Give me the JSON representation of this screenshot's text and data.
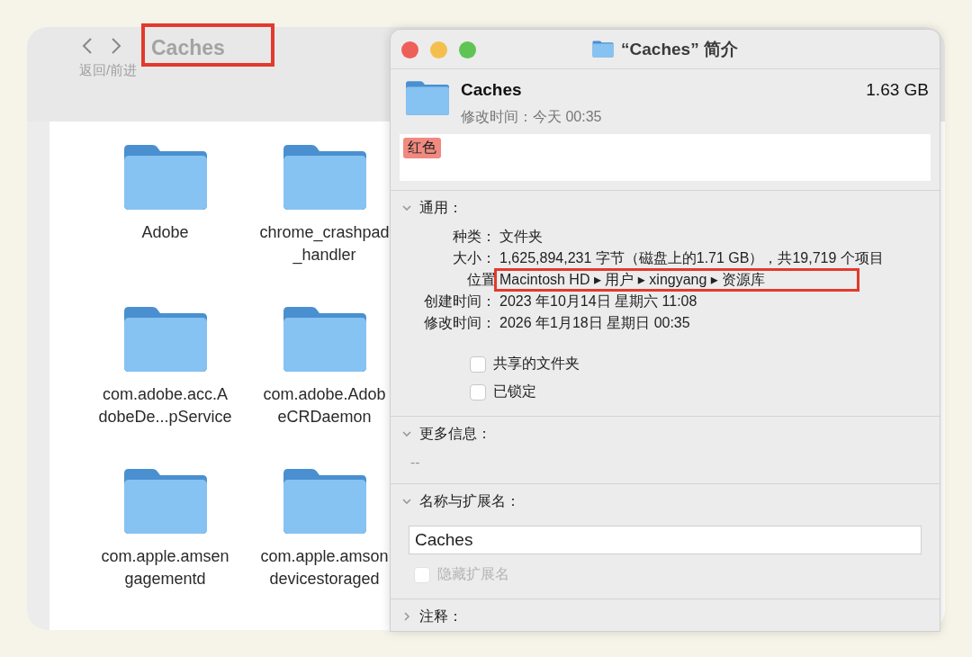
{
  "finder": {
    "title": "Caches",
    "nav_hint": "返回/前进",
    "items": [
      {
        "label_lines": [
          "Adobe"
        ]
      },
      {
        "label_lines": [
          "chrome_crashpad",
          "_handler"
        ]
      },
      {
        "label_lines": [
          "com.adobe.acc.A",
          "dobeDe...pService"
        ]
      },
      {
        "label_lines": [
          "com.adobe.Adob",
          "eCRDaemon"
        ]
      },
      {
        "label_lines": [
          "com.apple.amsen",
          "gagementd"
        ]
      },
      {
        "label_lines": [
          "com.apple.amson",
          "devicestoraged"
        ]
      }
    ]
  },
  "info": {
    "title": "“Caches” 简介",
    "name": "Caches",
    "size": "1.63 GB",
    "modified": "修改时间：今天 00:35",
    "tags": [
      {
        "label": "红色",
        "color": "#f08a80"
      }
    ],
    "sections": [
      {
        "kind": "general",
        "title": "通用：",
        "expanded": true,
        "rows": [
          {
            "label": "种类：",
            "value": "文件夹"
          },
          {
            "label": "大小：",
            "value": "1,625,894,231 字节（磁盘上的1.71 GB），共19,719 个项目"
          },
          {
            "label": "位置",
            "value": "Macintosh HD ▸ 用户 ▸ xingyang ▸ 资源库",
            "highlighted": true
          },
          {
            "label": "创建时间：",
            "value": "2023 年10月14日 星期六 11:08"
          },
          {
            "label": "修改时间：",
            "value": "2026 年1月18日 星期日 00:35"
          }
        ],
        "checkboxes": [
          {
            "label": "共享的文件夹",
            "checked": false,
            "disabled": false
          },
          {
            "label": "已锁定",
            "checked": false,
            "disabled": false
          }
        ]
      },
      {
        "kind": "more",
        "title": "更多信息：",
        "expanded": true,
        "text": "--"
      },
      {
        "kind": "name",
        "title": "名称与扩展名：",
        "expanded": true,
        "value": "Caches",
        "checkboxes": [
          {
            "label": "隐藏扩展名",
            "checked": false,
            "disabled": true
          }
        ]
      },
      {
        "kind": "comments",
        "title": "注释：",
        "expanded": false
      }
    ]
  }
}
